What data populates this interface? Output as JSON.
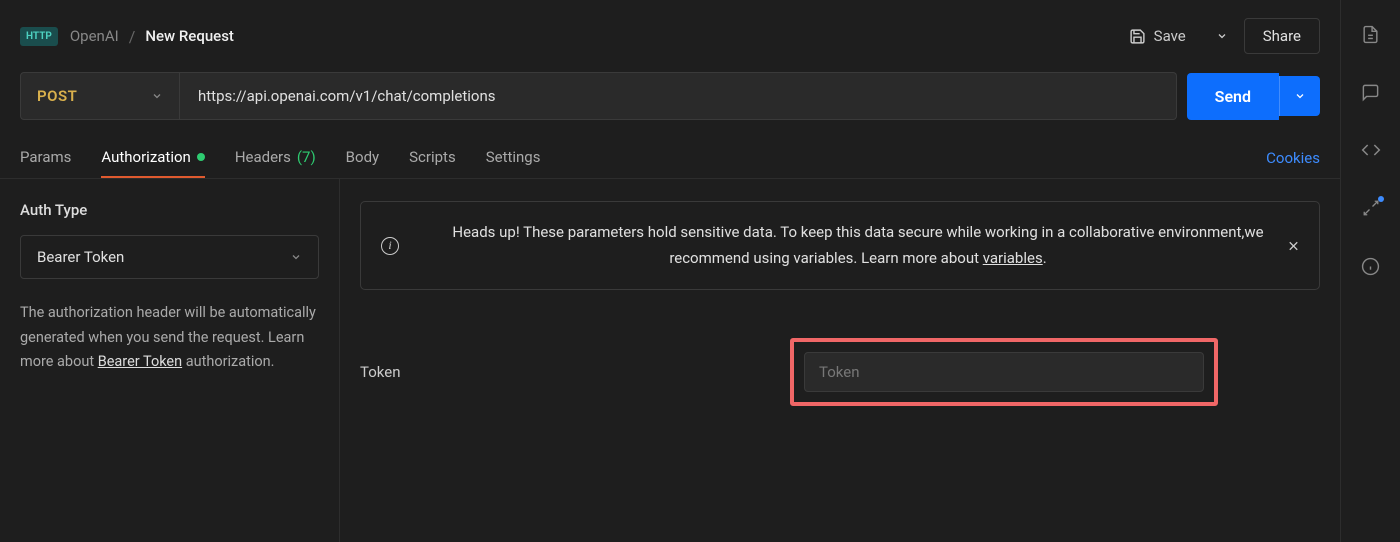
{
  "header": {
    "badge": "HTTP",
    "collection": "OpenAI",
    "request_name": "New Request",
    "save_label": "Save",
    "share_label": "Share"
  },
  "url_bar": {
    "method": "POST",
    "url": "https://api.openai.com/v1/chat/completions",
    "send_label": "Send"
  },
  "tabs": {
    "params": "Params",
    "authorization": "Authorization",
    "headers": "Headers",
    "headers_count": "(7)",
    "body": "Body",
    "scripts": "Scripts",
    "settings": "Settings",
    "cookies": "Cookies"
  },
  "auth": {
    "type_label": "Auth Type",
    "type_value": "Bearer Token",
    "help_prefix": "The authorization header will be automatically generated when you send the request. Learn more about ",
    "help_link": "Bearer Token",
    "help_suffix": " authorization."
  },
  "alert": {
    "text_prefix": "Heads up! These parameters hold sensitive data. To keep this data secure while working in a collaborative environment,we recommend using variables. Learn more about ",
    "link": "variables",
    "period": "."
  },
  "token": {
    "label": "Token",
    "placeholder": "Token",
    "value": ""
  }
}
